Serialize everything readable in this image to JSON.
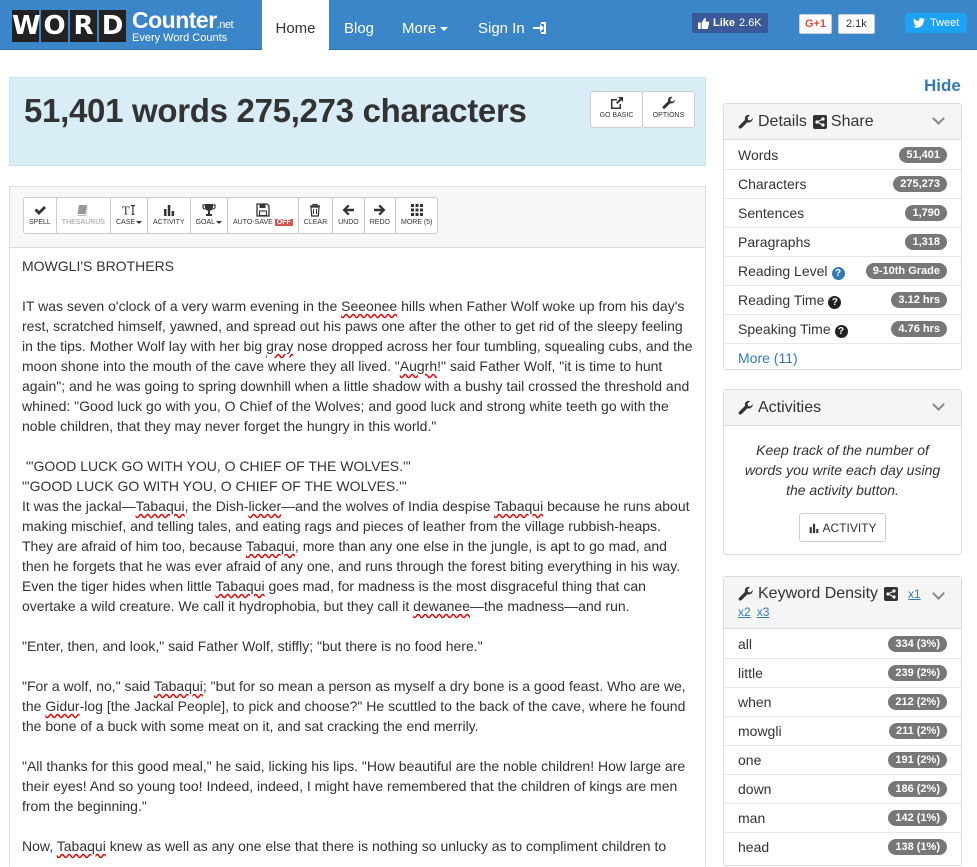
{
  "nav": {
    "logo_letters": [
      "W",
      "O",
      "R",
      "D"
    ],
    "logo_main": "Counter",
    "logo_net": ".net",
    "logo_sub": "Every Word Counts",
    "items": {
      "home": "Home",
      "blog": "Blog",
      "more": "More",
      "signin": "Sign In"
    },
    "fb_label": "Like",
    "fb_count": "2.6K",
    "gplus_label": "G+1",
    "gplus_count": "2.1k",
    "tweet_label": "Tweet"
  },
  "stats": {
    "headline": "51,401 words 275,273 characters",
    "go_basic": "GO BASIC",
    "options": "OPTIONS"
  },
  "toolbar": {
    "spell": "SPELL",
    "thesaurus": "THESAURUS",
    "case": "CASE",
    "activity": "ACTIVITY",
    "goal": "GOAL",
    "autosave": "AUTO-SAVE",
    "autosave_state": "OFF",
    "clear": "CLEAR",
    "undo": "UNDO",
    "redo": "REDO",
    "more": "MORE (5)"
  },
  "text": {
    "title": "MOWGLI'S BROTHERS",
    "p1a": "IT was seven o'clock of a very warm evening in the ",
    "p1w1": "Seeonee",
    "p1b": " hills when Father Wolf woke up from his day's rest, scratched himself, yawned, and spread out his paws one after the other to get rid of the sleepy feeling in the tips. Mother Wolf lay with her big ",
    "p1w2": "gray",
    "p1c": " nose dropped across her four tumbling, squealing cubs, and the moon shone into the mouth of the cave where they all lived. \"",
    "p1w3": "Augrh",
    "p1d": "!\" said Father Wolf, \"it is time to hunt again\"; and he was going to spring downhill when a little shadow with a bushy tail crossed the threshold and whined: \"Good luck go with you, O Chief of the Wolves; and good luck and strong white teeth go with the noble children, that they may never forget the hungry in this world.\"",
    "q1": " \"'GOOD LUCK GO WITH YOU, O CHIEF OF THE WOLVES.'\"",
    "q2": "\"'GOOD LUCK GO WITH YOU, O CHIEF OF THE WOLVES.'\"",
    "p2a": "It was the jackal—",
    "p2w1": "Tabaqui",
    "p2b": ", the Dish-",
    "p2w2": "licker",
    "p2c": "—and the wolves of India despise ",
    "p2w3": "Tabaqui",
    "p2d": " because he runs about making mischief, and telling tales, and eating rags and pieces of leather from the village rubbish-heaps. They are afraid of him too, because ",
    "p2w4": "Tabaqui",
    "p2e": ", more than any one else in the jungle, is apt to go mad, and then he forgets that he was ever afraid of any one, and runs through the forest biting everything in his way. Even the tiger hides when little ",
    "p2w5": "Tabaqui",
    "p2f": " goes mad, for madness is the most disgraceful thing that can overtake a wild creature. We call it hydrophobia, but they call it ",
    "p2w6": "dewanee",
    "p2g": "—the madness—and run.",
    "p3": "\"Enter, then, and look,\" said Father Wolf, stiffly; \"but there is no food here.\"",
    "p4a": "\"For a wolf, no,\" said ",
    "p4w1": "Tabaqui",
    "p4b": "; \"but for so mean a person as myself a dry bone is a good feast. Who are we, the ",
    "p4w2": "Gidur",
    "p4c": "-log [the Jackal People], to pick and choose?\" He scuttled to the back of the cave, where he found the bone of a buck with some meat on it, and sat cracking the end merrily.",
    "p5": "\"All thanks for this good meal,\" he said, licking his lips. \"How beautiful are the noble children! How large are their eyes! And so young too! Indeed, indeed, I might have remembered that the children of kings are men from the beginning.\"",
    "p6a": "Now, ",
    "p6w1": "Tabaqui",
    "p6b": " knew as well as any one else that there is nothing so unlucky as to compliment children to"
  },
  "sidebar": {
    "hide": "Hide",
    "details_title": "Details",
    "share_label": "Share",
    "details": [
      {
        "label": "Words",
        "value": "51,401"
      },
      {
        "label": "Characters",
        "value": "275,273"
      },
      {
        "label": "Sentences",
        "value": "1,790"
      },
      {
        "label": "Paragraphs",
        "value": "1,318"
      },
      {
        "label": "Reading Level",
        "value": "9-10th Grade"
      },
      {
        "label": "Reading Time",
        "value": "3.12 hrs"
      },
      {
        "label": "Speaking Time",
        "value": "4.76 hrs"
      }
    ],
    "details_more": "More (11)",
    "activities_title": "Activities",
    "activities_desc": "Keep track of the number of words you write each day using the activity button.",
    "activity_btn": "ACTIVITY",
    "kw_title": "Keyword Density",
    "kw_x1": "x1",
    "kw_x2": "x2",
    "kw_x3": "x3",
    "keywords": [
      {
        "word": "all",
        "value": "334 (3%)"
      },
      {
        "word": "little",
        "value": "239 (2%)"
      },
      {
        "word": "when",
        "value": "212 (2%)"
      },
      {
        "word": "mowgli",
        "value": "211 (2%)"
      },
      {
        "word": "one",
        "value": "191 (2%)"
      },
      {
        "word": "down",
        "value": "186 (2%)"
      },
      {
        "word": "man",
        "value": "142 (1%)"
      },
      {
        "word": "head",
        "value": "138 (1%)"
      }
    ]
  }
}
